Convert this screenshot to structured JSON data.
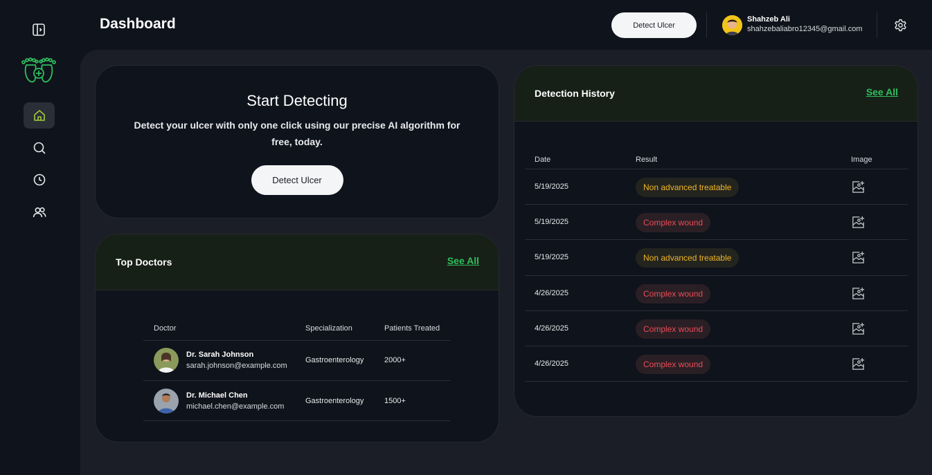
{
  "header": {
    "title": "Dashboard",
    "detect_button": "Detect Ulcer",
    "user_name": "Shahzeb Ali",
    "user_email": "shahzebaliabro12345@gmail.com"
  },
  "sidebar": {
    "items": [
      {
        "name": "home",
        "icon": "home-icon",
        "active": true
      },
      {
        "name": "search",
        "icon": "search-icon",
        "active": false
      },
      {
        "name": "history",
        "icon": "clock-icon",
        "active": false
      },
      {
        "name": "doctors",
        "icon": "users-icon",
        "active": false
      }
    ]
  },
  "start": {
    "title": "Start Detecting",
    "description": "Detect your ulcer with only one click using our precise AI algorithm for free, today.",
    "button": "Detect Ulcer"
  },
  "doctors": {
    "title": "Top Doctors",
    "see_all": "See All",
    "columns": [
      "Doctor",
      "Specialization",
      "Patients Treated"
    ],
    "rows": [
      {
        "name": "Dr. Sarah Johnson",
        "email": "sarah.johnson@example.com",
        "specialization": "Gastroenterology",
        "patients": "2000+"
      },
      {
        "name": "Dr. Michael Chen",
        "email": "michael.chen@example.com",
        "specialization": "Gastroenterology",
        "patients": "1500+"
      }
    ]
  },
  "history": {
    "title": "Detection History",
    "see_all": "See All",
    "columns": [
      "Date",
      "Result",
      "Image"
    ],
    "rows": [
      {
        "date": "5/19/2025",
        "result": "Non advanced treatable"
      },
      {
        "date": "5/19/2025",
        "result": "Complex wound"
      },
      {
        "date": "5/19/2025",
        "result": "Non advanced treatable"
      },
      {
        "date": "4/26/2025",
        "result": "Complex wound"
      },
      {
        "date": "4/26/2025",
        "result": "Complex wound"
      },
      {
        "date": "4/26/2025",
        "result": "Complex wound"
      }
    ]
  },
  "colors": {
    "accent_green": "#2fbf5e",
    "treatable": "#f1b725",
    "complex": "#ea4d57"
  }
}
